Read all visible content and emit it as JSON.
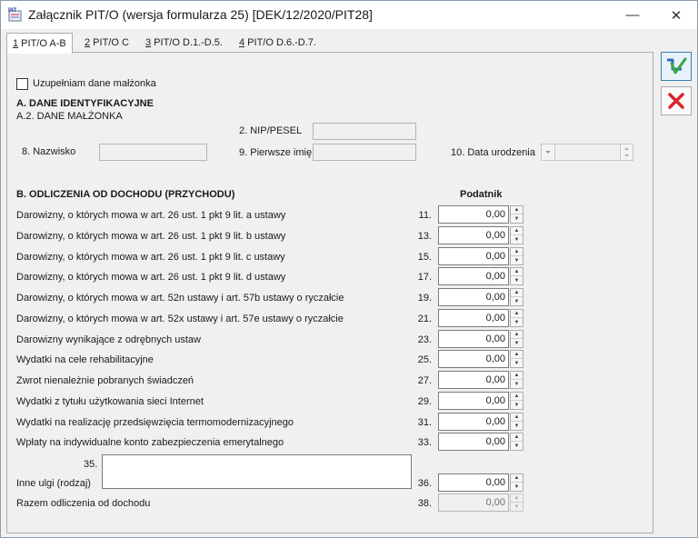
{
  "window": {
    "title": "Załącznik PIT/O (wersja formularza 25) [DEK/12/2020/PIT28]",
    "minimize_glyph": "—",
    "close_glyph": "✕",
    "icon": "pit-app-icon"
  },
  "tabs": [
    {
      "key": "1",
      "label": " PIT/O A-B",
      "active": true
    },
    {
      "key": "2",
      "label": " PIT/O C",
      "active": false
    },
    {
      "key": "3",
      "label": " PIT/O D.1.-D.5.",
      "active": false
    },
    {
      "key": "4",
      "label": " PIT/O D.6.-D.7.",
      "active": false
    }
  ],
  "spouse_checkbox": {
    "label": "Uzupełniam dane małżonka",
    "checked": false
  },
  "section_a": {
    "title": "A. DANE IDENTYFIKACYJNE",
    "subtitle": "A.2. DANE MAŁŻONKA",
    "nip_label": "2. NIP/PESEL",
    "nazwisko_label": "8. Nazwisko",
    "imie_label": "9. Pierwsze imię",
    "birth_label": "10. Data urodzenia"
  },
  "section_b": {
    "title": "B. ODLICZENIA OD DOCHODU (PRZYCHODU)",
    "column_header": "Podatnik",
    "rows": [
      {
        "label": "Darowizny, o których mowa w art. 26 ust. 1 pkt 9 lit. a ustawy",
        "num": "11.",
        "value": "0,00"
      },
      {
        "label": "Darowizny, o których mowa w art. 26 ust. 1 pkt 9 lit. b ustawy",
        "num": "13.",
        "value": "0,00"
      },
      {
        "label": "Darowizny, o których mowa w art. 26 ust. 1 pkt 9 lit. c ustawy",
        "num": "15.",
        "value": "0,00"
      },
      {
        "label": "Darowizny, o których mowa w art. 26 ust. 1 pkt 9 lit. d ustawy",
        "num": "17.",
        "value": "0,00"
      },
      {
        "label": "Darowizny, o których mowa w art. 52n ustawy i art. 57b ustawy o ryczałcie",
        "num": "19.",
        "value": "0,00"
      },
      {
        "label": "Darowizny, o których mowa w art. 52x ustawy i art. 57e ustawy o ryczałcie",
        "num": "21.",
        "value": "0,00"
      },
      {
        "label": "Darowizny wynikające z odrębnych ustaw",
        "num": "23.",
        "value": "0,00"
      },
      {
        "label": "Wydatki na cele rehabilitacyjne",
        "num": "25.",
        "value": "0,00"
      },
      {
        "label": "Zwrot nienależnie pobranych świadczeń",
        "num": "27.",
        "value": "0,00"
      },
      {
        "label": "Wydatki z tytułu użytkowania sieci Internet",
        "num": "29.",
        "value": "0,00"
      },
      {
        "label": "Wydatki na realizację przedsięwzięcia termomodernizacyjnego",
        "num": "31.",
        "value": "0,00"
      },
      {
        "label": "Wpłaty na indywidualne konto zabezpieczenia emerytalnego",
        "num": "33.",
        "value": "0,00"
      }
    ],
    "other_reliefs": {
      "num_top": "35.",
      "label": "Inne ulgi (rodzaj)",
      "num": "36.",
      "value": "0,00"
    },
    "total": {
      "label": "Razem odliczenia od dochodu",
      "num": "38.",
      "value": "0,00"
    }
  },
  "side_buttons": {
    "save_icon": "save-confirm-icon",
    "cancel_icon": "cancel-x-icon"
  },
  "colors": {
    "accent_blue": "#2a6ebb",
    "cancel_red": "#d9262c",
    "field_border": "#7a7a7a"
  }
}
